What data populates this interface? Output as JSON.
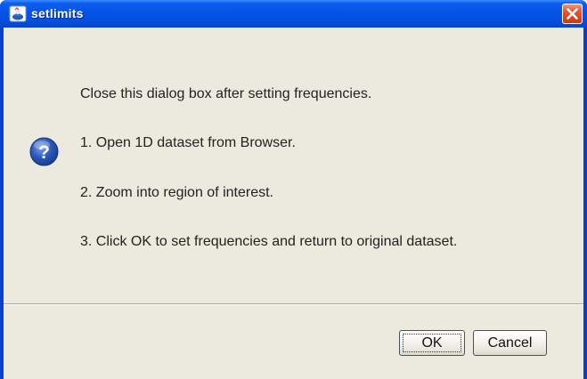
{
  "window": {
    "title": "setlimits",
    "app_icon": "duke-java-icon",
    "close_icon": "close-x-icon"
  },
  "dialog": {
    "icon": "question-icon",
    "messages": [
      "Close this dialog box after setting frequencies.",
      "1. Open 1D dataset from Browser.",
      "2. Zoom into region of interest.",
      "3. Click OK to set frequencies and return to original dataset."
    ]
  },
  "buttons": {
    "ok_label": "OK",
    "cancel_label": "Cancel"
  },
  "colors": {
    "titlebar_blue": "#0653e6",
    "client_background": "#eceade",
    "close_red": "#d8451f",
    "question_blue": "#2a55b8"
  }
}
